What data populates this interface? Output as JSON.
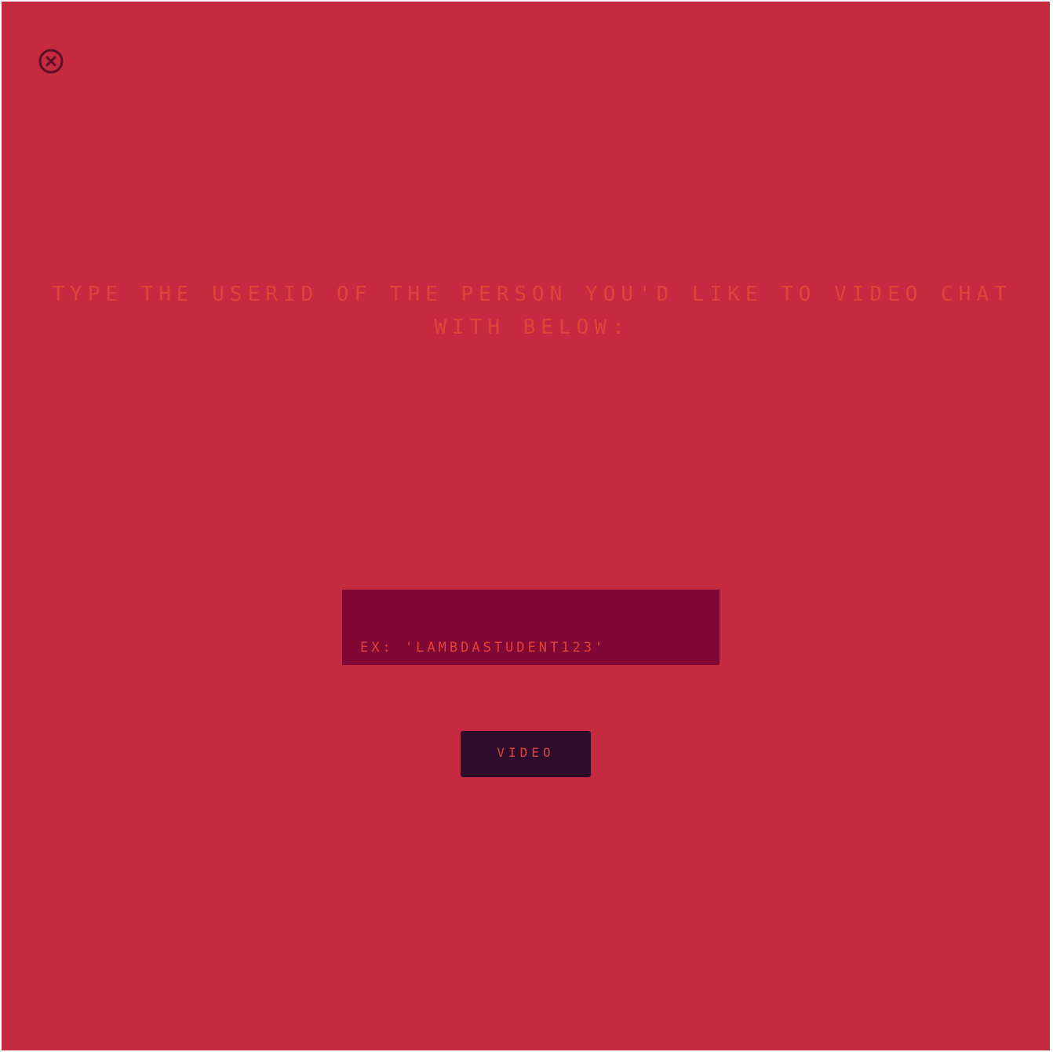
{
  "colors": {
    "background": "#c62a40",
    "text_accent": "#e0433c",
    "input_background": "#810834",
    "button_background": "#2d0d2b",
    "close_icon": "#5b0f22"
  },
  "close": {
    "icon": "close-circle-icon"
  },
  "prompt": {
    "text": "Type the userid of the person you'd like to video chat with below:"
  },
  "userid_input": {
    "placeholder": "ex: 'lambdastudent123'",
    "value": ""
  },
  "video_button": {
    "label": "Video"
  }
}
